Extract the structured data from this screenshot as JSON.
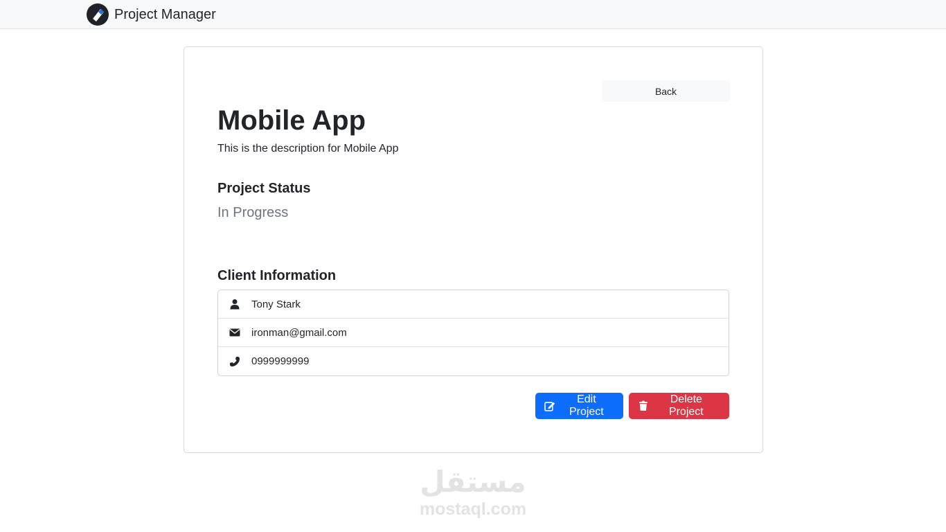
{
  "navbar": {
    "brand_name": "Project Manager",
    "logo_icon": "project-logo-icon"
  },
  "project": {
    "back_label": "Back",
    "title": "Mobile App",
    "description": "This is the description for Mobile App",
    "status_heading": "Project Status",
    "status_value": "In Progress",
    "client_heading": "Client Information",
    "client": {
      "name": "Tony Stark",
      "email": "ironman@gmail.com",
      "phone": "0999999999"
    },
    "edit_label": "Edit Project",
    "delete_label": "Delete Project"
  },
  "watermark": {
    "arabic": "مستقل",
    "latin": "mostaql.com"
  },
  "colors": {
    "primary": "#0d6efd",
    "danger": "#dc3545",
    "navbar_bg": "#f8f9fa",
    "muted": "#6c757d"
  }
}
